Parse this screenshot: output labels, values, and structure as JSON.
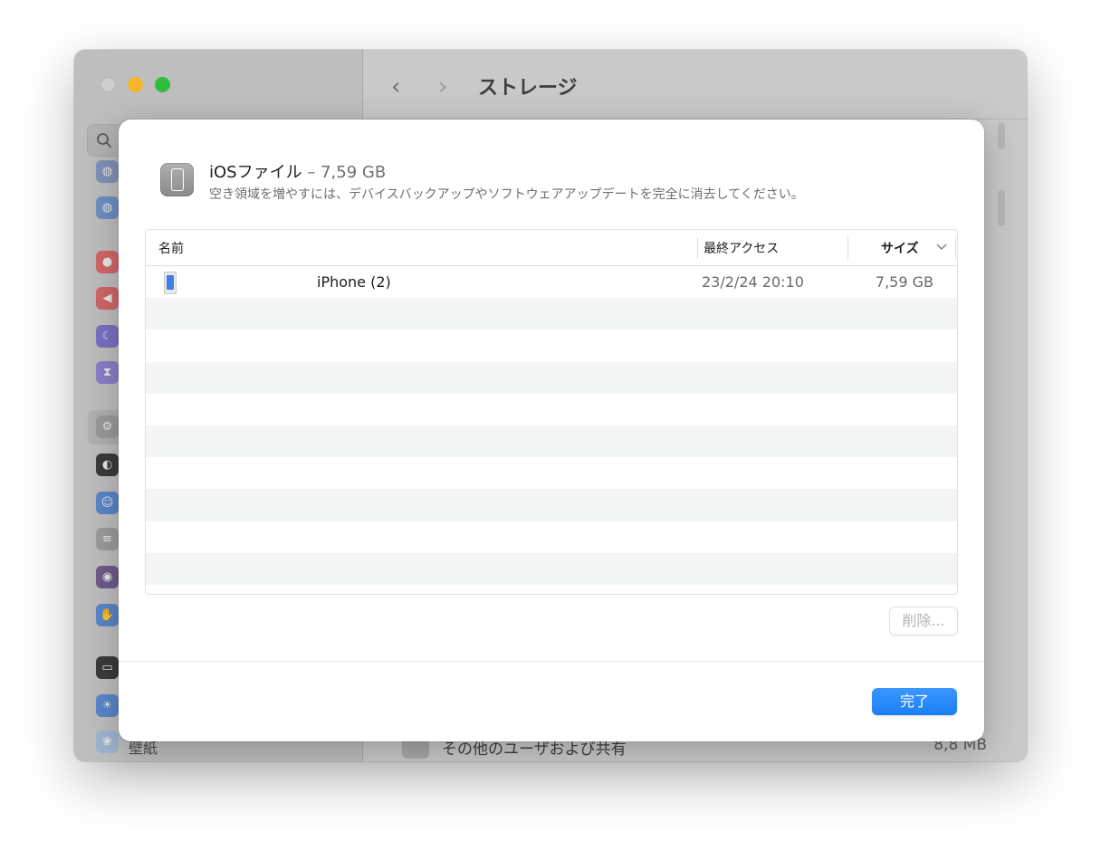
{
  "window": {
    "title": "ストレージ",
    "sidebar": {
      "visible_label": "壁紙"
    },
    "background_row": {
      "label": "その他のユーザおよび共有",
      "size": "8,8 MB"
    }
  },
  "sheet": {
    "title_name": "iOSファイル",
    "title_size": "– 7,59 GB",
    "subtitle": "空き領域を増やすには、デバイスバックアップやソフトウェアアップデートを完全に消去してください。",
    "table": {
      "columns": {
        "name": "名前",
        "last_access": "最終アクセス",
        "size": "サイズ"
      },
      "rows": [
        {
          "name": "iPhone (2)",
          "last_access": "23/2/24 20:10",
          "size": "7,59 GB"
        }
      ]
    },
    "delete_label": "削除...",
    "done_label": "完了"
  },
  "colors": {
    "accent": "#1a7ff6",
    "traffic_min": "#f2b72f",
    "traffic_max": "#2fbe3c"
  }
}
